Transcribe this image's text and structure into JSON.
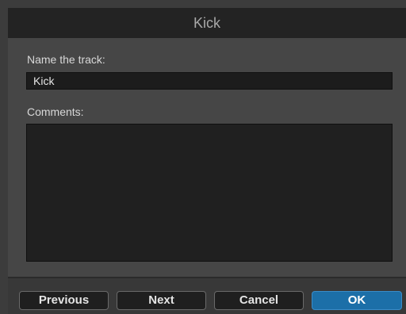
{
  "dialog": {
    "title": "Kick"
  },
  "form": {
    "name_label": "Name the track:",
    "name_value": "Kick",
    "comments_label": "Comments:",
    "comments_value": ""
  },
  "buttons": {
    "previous": "Previous",
    "next": "Next",
    "cancel": "Cancel",
    "ok": "OK"
  },
  "colors": {
    "accent_ok_button": "#1c6fa8",
    "dialog_background": "#464646",
    "title_bar": "#232323"
  }
}
